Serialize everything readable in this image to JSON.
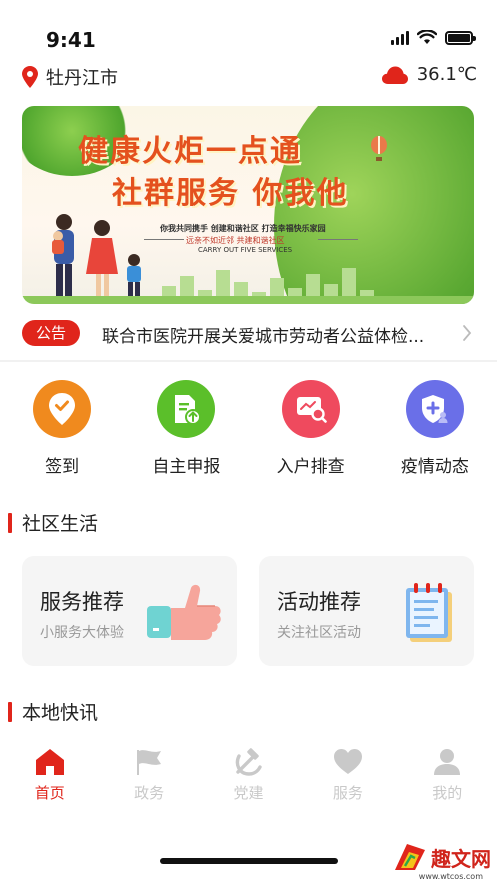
{
  "status_bar": {
    "time": "9:41"
  },
  "location": {
    "city": "牡丹江市"
  },
  "weather": {
    "temperature": "36.1℃"
  },
  "banner": {
    "title_line1": "健康火炬一点通",
    "title_line2": "社群服务 你我他",
    "sub_line1": "你我共同携手 创建和谐社区 打造幸福快乐家园",
    "sub_line2": "远亲不如近邻  共建和谐社区",
    "sub_line3": "CARRY OUT FIVE SERVICES"
  },
  "notice": {
    "badge": "公告",
    "text": "联合市医院开展关爱城市劳动者公益体检..."
  },
  "actions": [
    {
      "label": "签到",
      "icon": "location-check-icon",
      "color": "#f08a1e"
    },
    {
      "label": "自主申报",
      "icon": "document-upload-icon",
      "color": "#5bbf2a"
    },
    {
      "label": "入户排查",
      "icon": "search-screen-icon",
      "color": "#ef4a5e"
    },
    {
      "label": "疫情动态",
      "icon": "shield-plus-icon",
      "color": "#6a6fe8"
    }
  ],
  "sections": {
    "community_life": "社区生活",
    "local_news": "本地快讯"
  },
  "cards": [
    {
      "title": "服务推荐",
      "subtitle": "小服务大体验",
      "icon": "thumbs-up-icon"
    },
    {
      "title": "活动推荐",
      "subtitle": "关注社区活动",
      "icon": "notepad-icon"
    }
  ],
  "tabs": [
    {
      "label": "首页",
      "icon": "home-icon",
      "active": true
    },
    {
      "label": "政务",
      "icon": "flag-icon",
      "active": false
    },
    {
      "label": "党建",
      "icon": "hammer-sickle-icon",
      "active": false
    },
    {
      "label": "服务",
      "icon": "heart-icon",
      "active": false
    },
    {
      "label": "我的",
      "icon": "user-icon",
      "active": false
    }
  ],
  "colors": {
    "accent": "#e0251b",
    "inactive_tab": "#c9c9c9"
  },
  "watermark": {
    "text": "趣文网",
    "url": "www.wtcos.com"
  }
}
